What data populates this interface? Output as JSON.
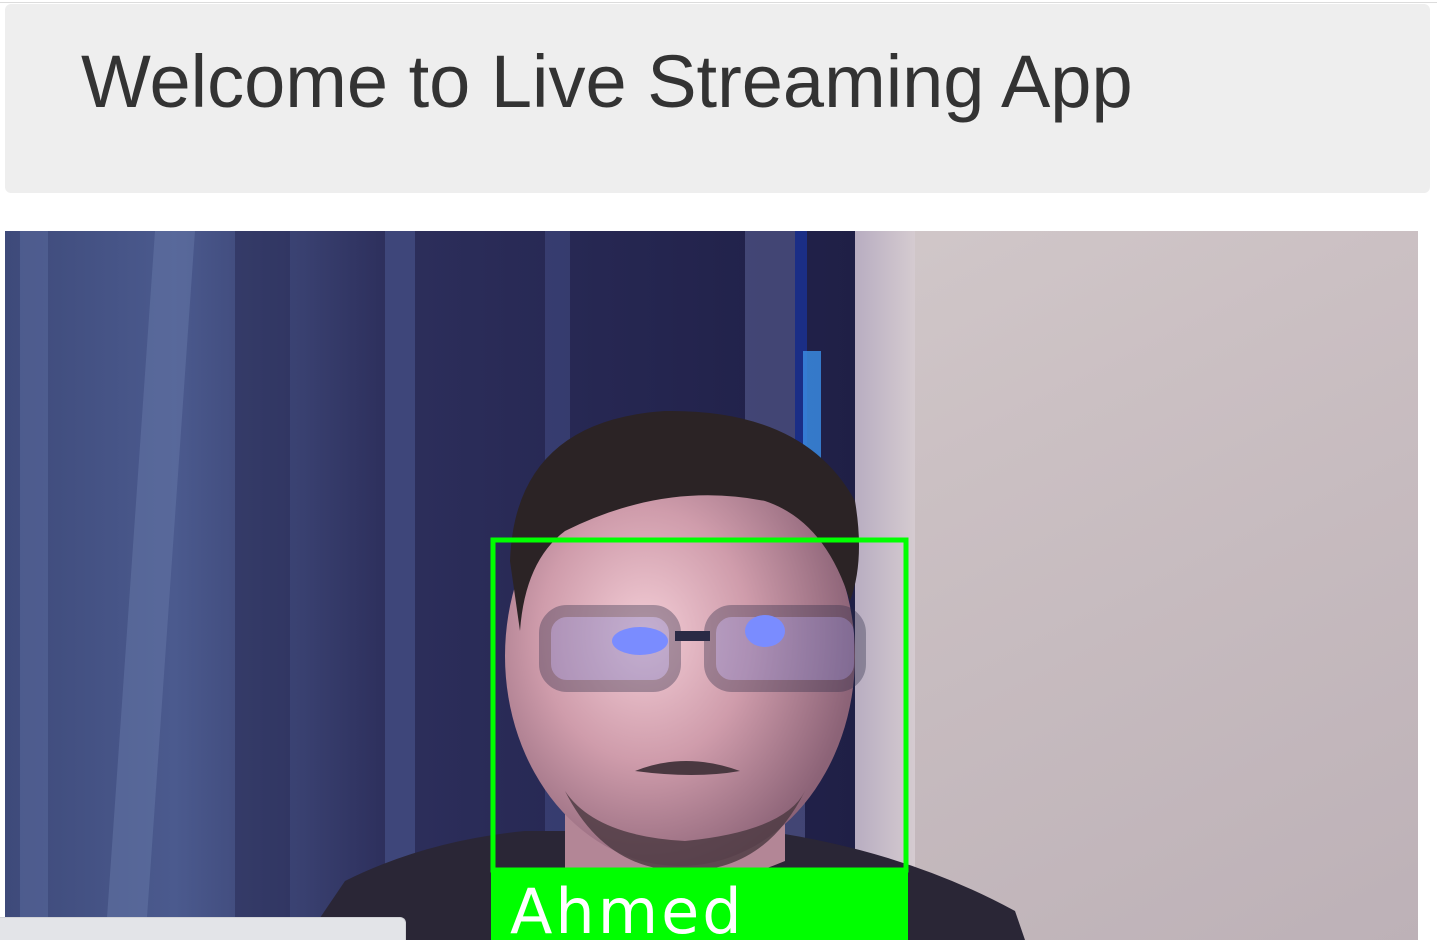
{
  "header": {
    "title": "Welcome to Live Streaming App"
  },
  "video": {
    "face_label": "Ahmed",
    "detection_box_color": "#00ff00",
    "label_text_color": "#ffffff"
  }
}
